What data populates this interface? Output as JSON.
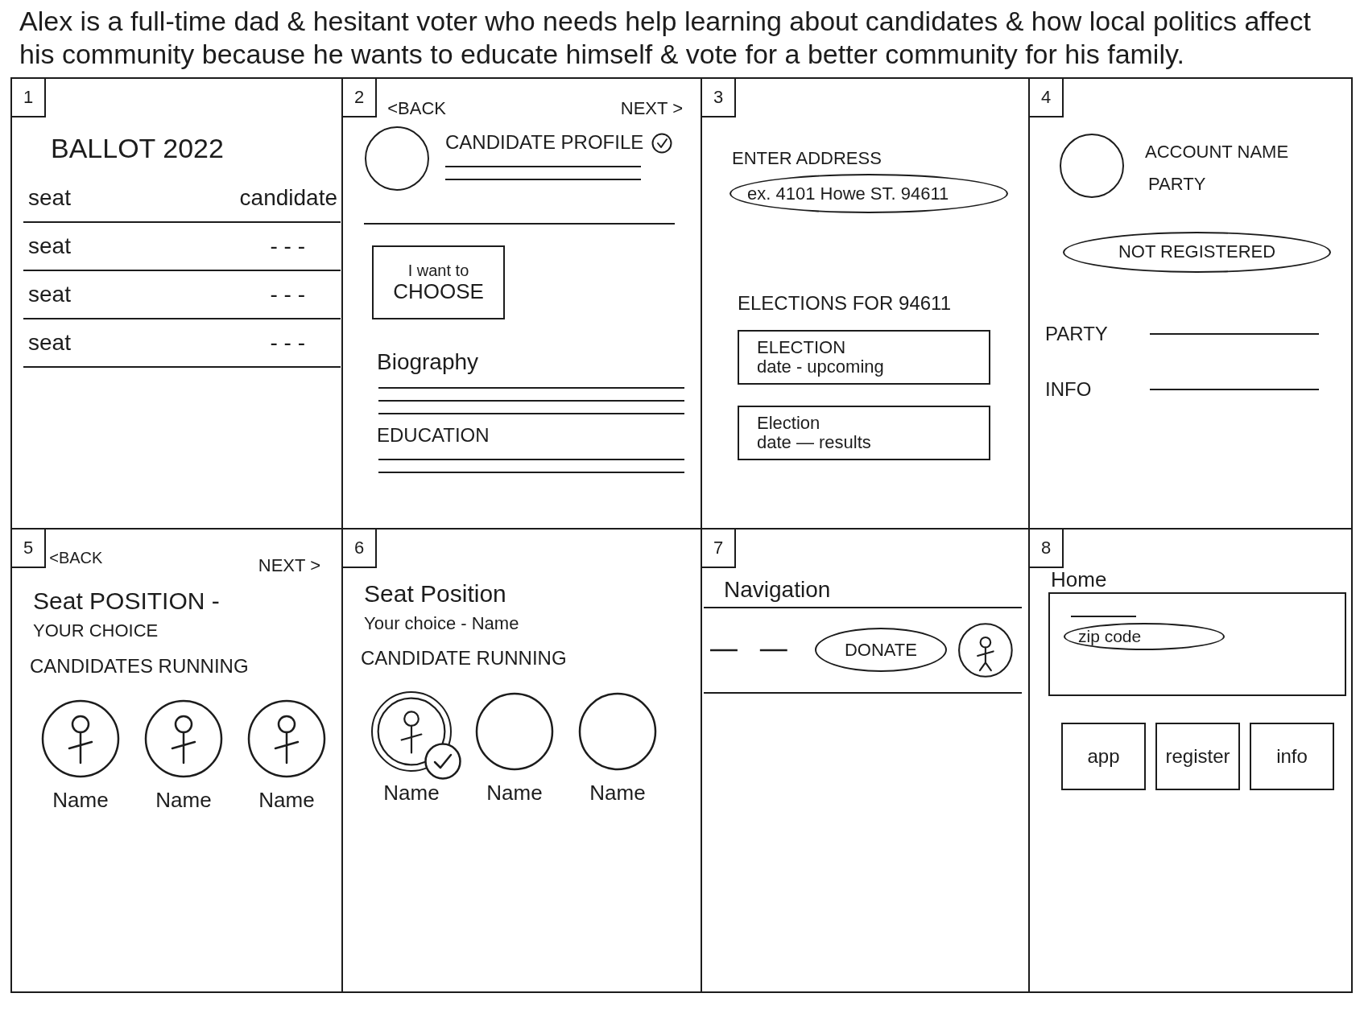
{
  "caption": "Alex is a full-time dad & hesitant voter who needs help learning about candidates & how local politics affect his community because he wants to educate himself & vote for a better community for his family.",
  "frames": [
    {
      "number": "1",
      "kind": "ballot",
      "title": "BALLOT 2022",
      "columns": [
        "seat",
        "candidate"
      ],
      "rows": [
        {
          "seat": "seat",
          "candidate": "- - -"
        },
        {
          "seat": "seat",
          "candidate": "- - -"
        },
        {
          "seat": "seat",
          "candidate": "- - -"
        }
      ]
    },
    {
      "number": "2",
      "kind": "profile",
      "back": "<BACK",
      "next": "NEXT >",
      "title": "CANDIDATE PROFILE",
      "verified": true,
      "choose_button": [
        "I want to",
        "CHOOSE"
      ],
      "sections": [
        "Biography",
        "EDUCATION"
      ]
    },
    {
      "number": "3",
      "kind": "address",
      "label": "ENTER ADDRESS",
      "placeholder": "ex. 4101 Howe ST. 94611",
      "elections_heading": "ELECTIONS FOR 94611",
      "elections": [
        {
          "title": "ELECTION",
          "detail": "date - upcoming"
        },
        {
          "title": "Election",
          "detail": "date — results"
        }
      ]
    },
    {
      "number": "4",
      "kind": "account",
      "account_name": "ACCOUNT NAME",
      "party": "PARTY",
      "status": "NOT REGISTERED",
      "fields": [
        "PARTY",
        "INFO"
      ]
    },
    {
      "number": "5",
      "kind": "seat",
      "back": "<BACK",
      "next": "NEXT >",
      "title": "Seat POSITION -",
      "choice": "YOUR CHOICE",
      "heading": "CANDIDATES RUNNING",
      "candidates": [
        {
          "name": "Name",
          "kind": "figure",
          "selected": false
        },
        {
          "name": "Name",
          "kind": "figure",
          "selected": false
        },
        {
          "name": "Name",
          "kind": "figure",
          "selected": false
        }
      ]
    },
    {
      "number": "6",
      "kind": "seat",
      "title": "Seat Position",
      "choice": "Your choice - Name",
      "heading": "CANDIDATE RUNNING",
      "candidates": [
        {
          "name": "Name",
          "kind": "figure",
          "selected": true
        },
        {
          "name": "Name",
          "kind": "empty",
          "selected": false
        },
        {
          "name": "Name",
          "kind": "empty",
          "selected": false
        }
      ]
    },
    {
      "number": "7",
      "kind": "navigation",
      "title": "Navigation",
      "donate": "DONATE"
    },
    {
      "number": "8",
      "kind": "home",
      "title": "Home",
      "zip_placeholder": "zip code",
      "buttons": [
        "app",
        "register",
        "info"
      ]
    }
  ]
}
